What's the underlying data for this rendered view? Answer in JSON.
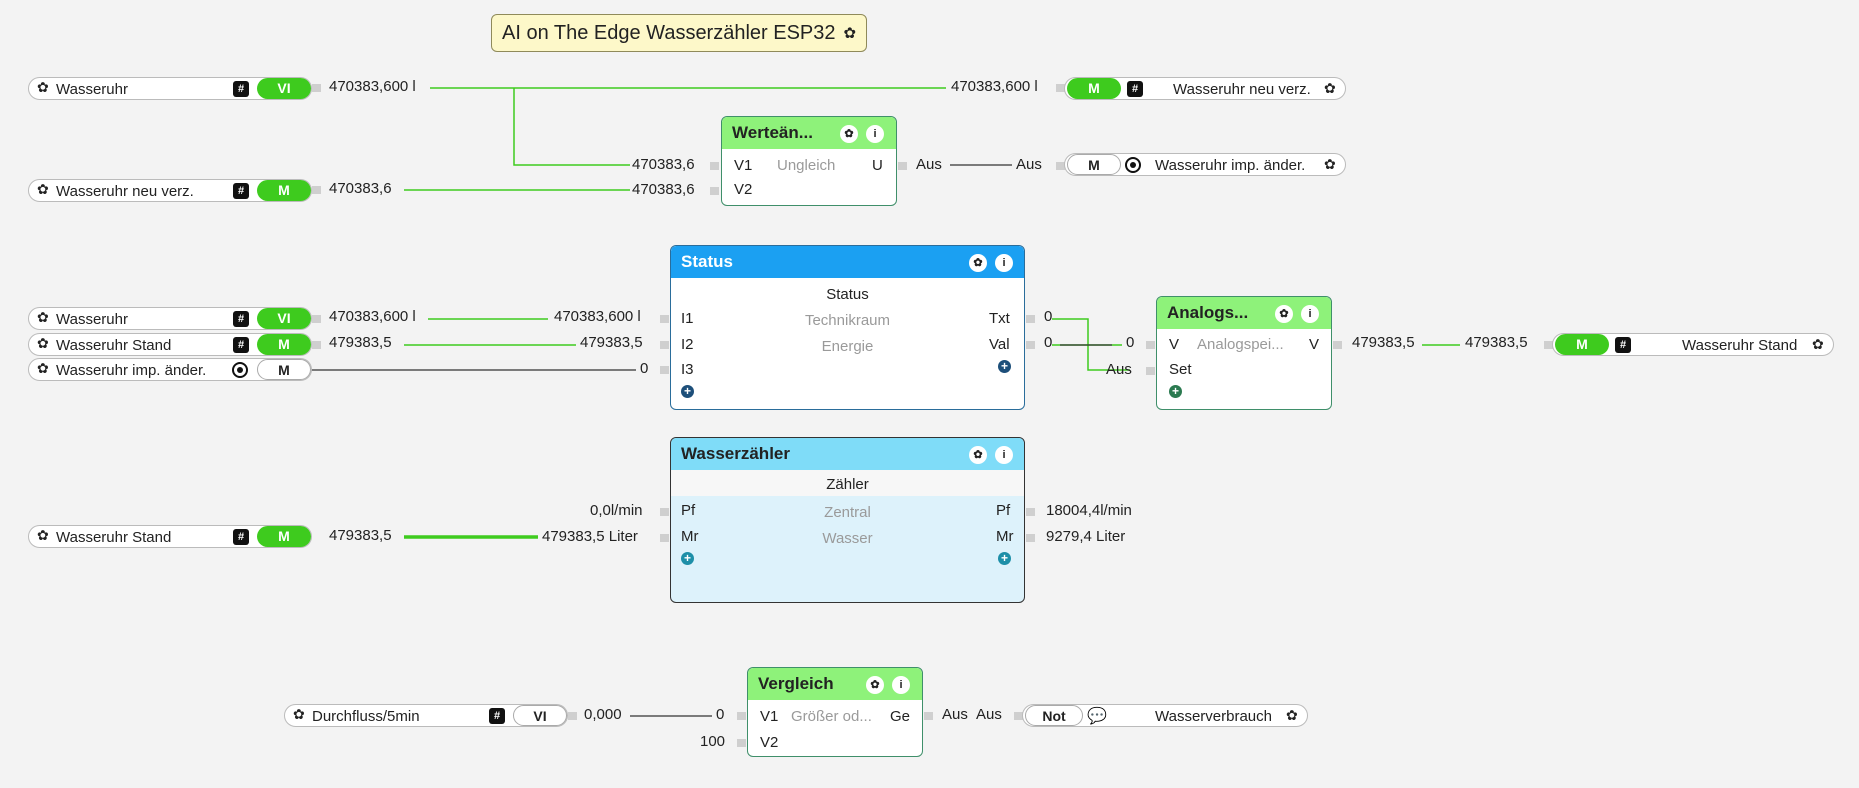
{
  "title": "AI on The Edge Wasserzähler ESP32",
  "icons": {
    "gear": "gear-icon",
    "info": "info-icon",
    "hash": "hash-icon",
    "radio": "radio-icon",
    "speech": "speech-bubble-icon",
    "plus": "plus-icon"
  },
  "colors": {
    "wire": "#3ecb1e",
    "green_badge": "#3ecb1e",
    "status_head": "#1ba0f2",
    "zaehler_head": "#7fdcf8",
    "green_head": "#8ef27a"
  },
  "inputs": {
    "wasseruhr_1": {
      "name": "Wasseruhr",
      "badge": "VI",
      "value": "470383,600 l"
    },
    "wasseruhr_neu_verz": {
      "name": "Wasseruhr neu verz.",
      "badge": "M",
      "value": "470383,6"
    },
    "wasseruhr_2": {
      "name": "Wasseruhr",
      "badge": "VI",
      "value": "470383,600 l"
    },
    "wasseruhr_stand": {
      "name": "Wasseruhr Stand",
      "badge": "M",
      "value": "479383,5"
    },
    "wasseruhr_imp": {
      "name": "Wasseruhr imp. änder.",
      "badge": "M"
    },
    "wasseruhr_stand_2": {
      "name": "Wasseruhr Stand",
      "badge": "M",
      "value": "479383,5"
    },
    "durchfluss": {
      "name": "Durchfluss/5min",
      "badge": "VI",
      "value": "0,000"
    }
  },
  "outputs": {
    "neu_verz": {
      "name": "Wasseruhr neu verz.",
      "badge": "M",
      "value": "470383,600 l"
    },
    "imp_aender": {
      "name": "Wasseruhr imp. änder.",
      "badge": "M",
      "value": "Aus"
    },
    "stand": {
      "name": "Wasseruhr Stand",
      "badge": "M",
      "value": "479383,5"
    },
    "wasserverbrauch": {
      "name": "Wasserverbrauch",
      "badge": "Not",
      "value": "Aus"
    }
  },
  "blocks": {
    "wertaenderung": {
      "title": "Werteän...",
      "type": "Ungleich",
      "in1": "V1",
      "in2": "V2",
      "out": "U",
      "in1_val": "470383,6",
      "in2_val": "470383,6",
      "out_val": "Aus"
    },
    "status": {
      "title": "Status",
      "sub1": "Status",
      "sub2": "Technikraum",
      "sub3": "Energie",
      "in1": "I1",
      "in2": "I2",
      "in3": "I3",
      "out1": "Txt",
      "out2": "Val",
      "in1_val": "470383,600 l",
      "in2_val": "479383,5",
      "in3_val": "0",
      "out1_val": "0",
      "out2_val": "0"
    },
    "analog": {
      "title": "Analogs...",
      "type": "Analogspei...",
      "in1": "V",
      "in2": "Set",
      "out": "V",
      "in1_val": "0",
      "in2_val": "Aus",
      "out_val": "479383,5"
    },
    "zaehler": {
      "title": "Wasserzähler",
      "sub1": "Zähler",
      "sub2": "Zentral",
      "sub3": "Wasser",
      "in1": "Pf",
      "in2": "Mr",
      "out1": "Pf",
      "out2": "Mr",
      "in1_val": "0,0l/min",
      "in2_val": "479383,5 Liter",
      "out1_val": "18004,4l/min",
      "out2_val": "9279,4 Liter"
    },
    "vergleich": {
      "title": "Vergleich",
      "type": "Größer od...",
      "in1": "V1",
      "in2": "V2",
      "out": "Ge",
      "in1_val": "0",
      "in2_val": "100",
      "out_val": "Aus"
    }
  }
}
